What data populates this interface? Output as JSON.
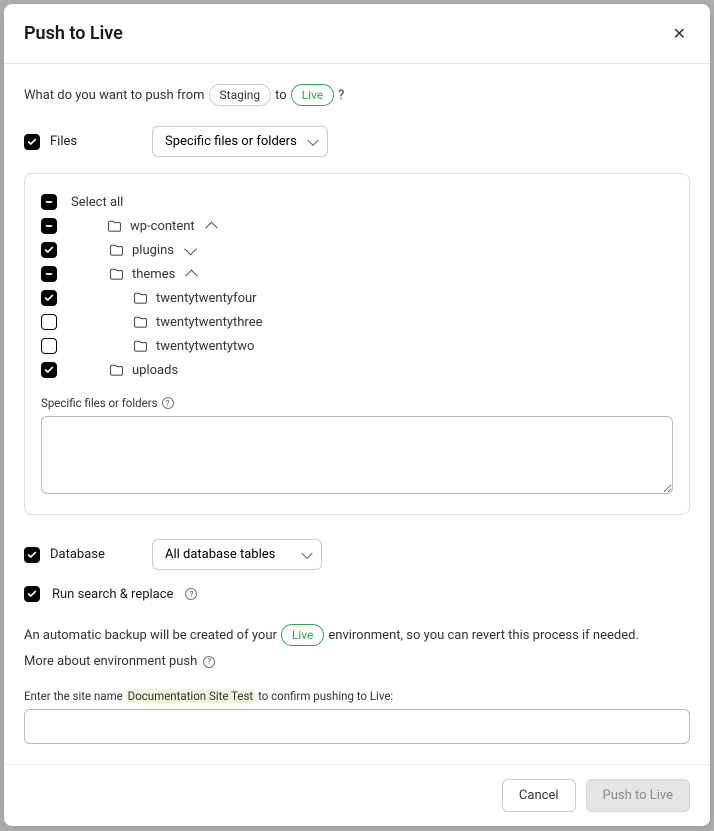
{
  "header": {
    "title": "Push to Live"
  },
  "intro": {
    "prefix": "What do you want to push from",
    "from": "Staging",
    "mid": "to",
    "to": "Live",
    "suffix": "?"
  },
  "files": {
    "label": "Files",
    "mode": "Specific files or folders",
    "tree": {
      "select_all": "Select all",
      "wp_content": "wp-content",
      "plugins": "plugins",
      "themes": "themes",
      "twentytwentyfour": "twentytwentyfour",
      "twentytwentythree": "twentytwentythree",
      "twentytwentytwo": "twentytwentytwo",
      "uploads": "uploads"
    },
    "specific_label": "Specific files or folders",
    "specific_value": ""
  },
  "database": {
    "label": "Database",
    "mode": "All database tables"
  },
  "search_replace": {
    "label": "Run search & replace"
  },
  "backup_info": {
    "prefix": "An automatic backup will be created of your",
    "env": "Live",
    "suffix": "environment, so you can revert this process if needed."
  },
  "more_link": "More about environment push",
  "confirm": {
    "prefix": "Enter the site name",
    "site_name": "Documentation Site Test",
    "suffix": "to confirm pushing to Live:",
    "value": ""
  },
  "footer": {
    "cancel": "Cancel",
    "submit": "Push to Live"
  }
}
